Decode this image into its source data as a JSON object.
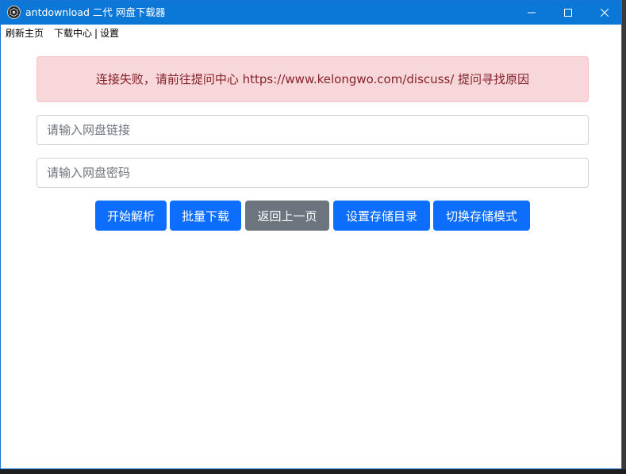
{
  "window": {
    "title": "antdownload 二代 网盘下载器",
    "app_icon": "antdownload-logo-icon",
    "controls": [
      "minimize-icon",
      "maximize-icon",
      "close-icon"
    ]
  },
  "menu": {
    "refresh": "刷新主页",
    "download_center": "下载中心",
    "separator": "|",
    "settings": "设置"
  },
  "alert": {
    "message": "连接失败，请前往提问中心 https://www.kelongwo.com/discuss/ 提问寻找原因"
  },
  "form": {
    "link_placeholder": "请输入网盘链接",
    "link_value": "",
    "password_placeholder": "请输入网盘密码",
    "password_value": ""
  },
  "buttons": {
    "parse": "开始解析",
    "batch_download": "批量下载",
    "back": "返回上一页",
    "set_directory": "设置存储目录",
    "switch_mode": "切换存储模式"
  },
  "colors": {
    "titlebar": "#0b78d7",
    "primary": "#0d6efd",
    "secondary": "#6c757d",
    "alert_bg": "#f8d7da",
    "alert_text": "#842029"
  }
}
